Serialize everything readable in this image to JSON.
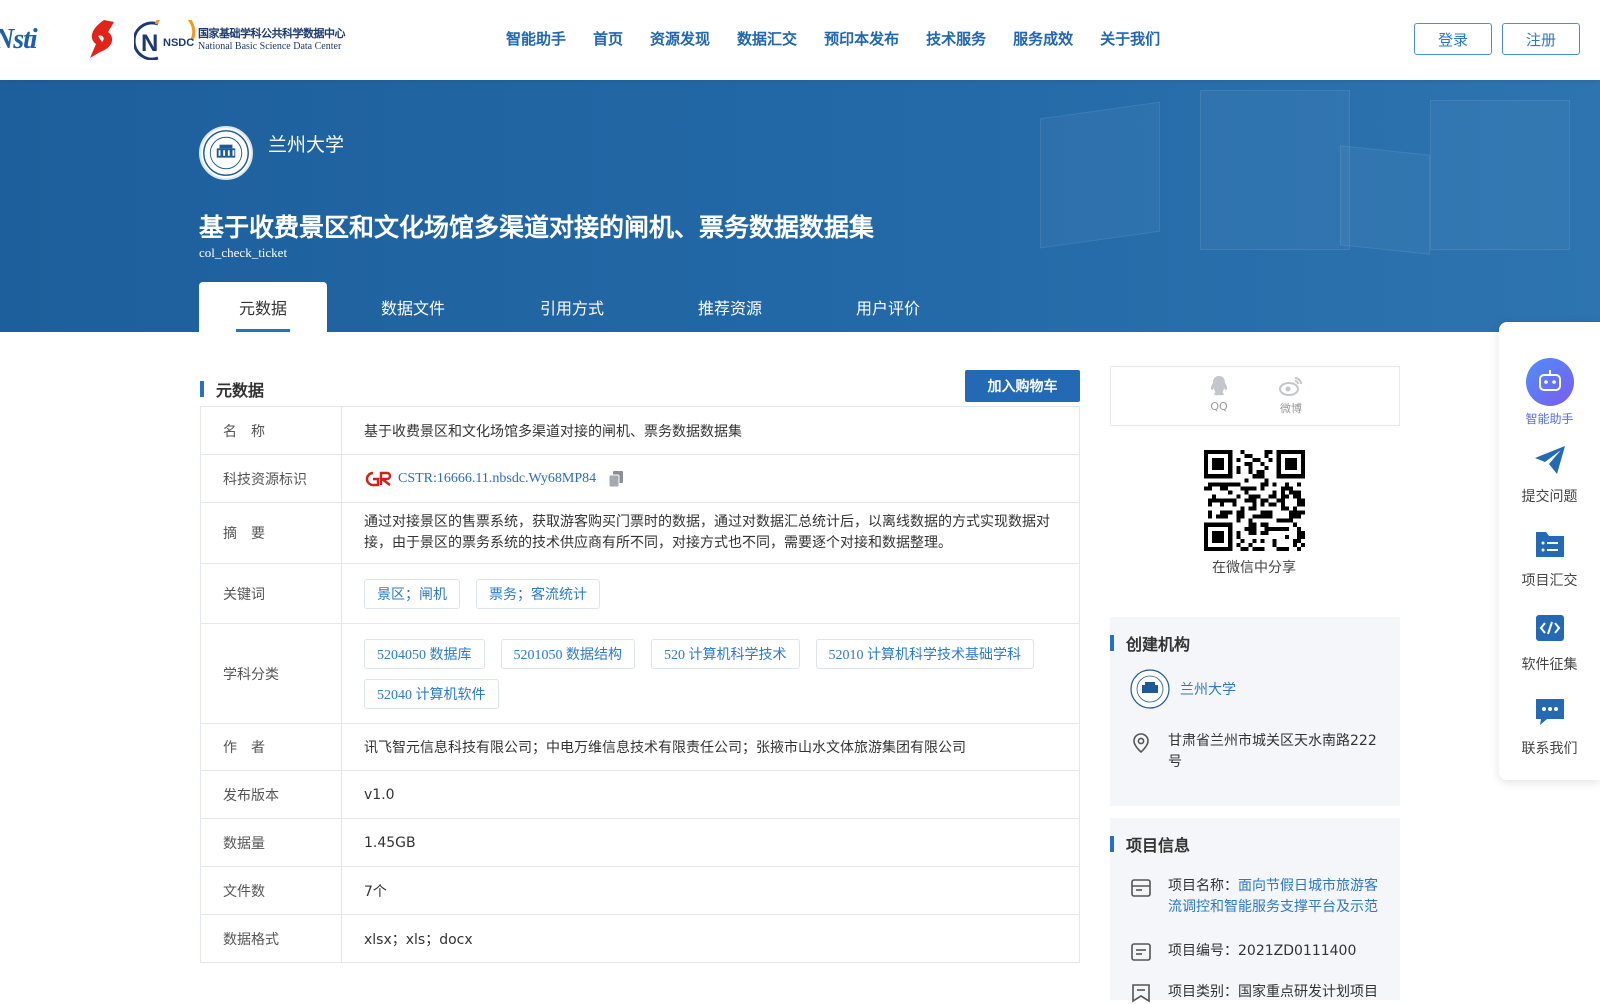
{
  "nav": {
    "items": [
      "智能助手",
      "首页",
      "资源发现",
      "数据汇交",
      "预印本发布",
      "技术服务",
      "服务成效",
      "关于我们"
    ],
    "login": "登录",
    "register": "注册"
  },
  "logos": {
    "nsti": "Nsti",
    "nsdc_badge": "NSDC",
    "nsdc_cn": "国家基础学科公共科学数据中心",
    "nsdc_en": "National Basic Science Data Center"
  },
  "header": {
    "institution": "兰州大学",
    "title": "基于收费景区和文化场馆多渠道对接的闸机、票务数据数据集",
    "code": "col_check_ticket",
    "tabs": [
      "元数据",
      "数据文件",
      "引用方式",
      "推荐资源",
      "用户评价"
    ]
  },
  "metadata": {
    "section_title": "元数据",
    "cart_button": "加入购物车",
    "rows": {
      "name": {
        "label": "名　称",
        "value": "基于收费景区和文化场馆多渠道对接的闸机、票务数据数据集"
      },
      "cstr": {
        "label": "科技资源标识",
        "value": "CSTR:16666.11.nbsdc.Wy68MP84"
      },
      "abstract": {
        "label": "摘　要",
        "value": "通过对接景区的售票系统，获取游客购买门票时的数据，通过对数据汇总统计后，以离线数据的方式实现数据对接，由于景区的票务系统的技术供应商有所不同，对接方式也不同，需要逐个对接和数据整理。"
      },
      "keywords": {
        "label": "关键词",
        "tags": [
          "景区；闸机",
          "票务；客流统计"
        ]
      },
      "subjects": {
        "label": "学科分类",
        "tags": [
          "5204050 数据库",
          "5201050 数据结构",
          "520 计算机科学技术",
          "52010 计算机科学技术基础学科",
          "52040 计算机软件"
        ]
      },
      "authors": {
        "label": "作　者",
        "value": "讯飞智元信息科技有限公司；中电万维信息技术有限责任公司；张掖市山水文体旅游集团有限公司"
      },
      "version": {
        "label": "发布版本",
        "value": "v1.0"
      },
      "size": {
        "label": "数据量",
        "value": "1.45GB"
      },
      "files": {
        "label": "文件数",
        "value": "7个"
      },
      "format": {
        "label": "数据格式",
        "value": "xlsx；xls；docx"
      }
    }
  },
  "share": {
    "qq": "QQ",
    "weibo": "微博",
    "wechat_caption": "在微信中分享"
  },
  "creator": {
    "title": "创建机构",
    "name": "兰州大学",
    "address": "甘肃省兰州市城关区天水南路222号"
  },
  "project": {
    "title": "项目信息",
    "name_label": "项目名称：",
    "name_value": "面向节假日城市旅游客流调控和智能服务支撑平台及示范",
    "number": "项目编号：2021ZD0111400",
    "category": "项目类别：国家重点研发计划项目"
  },
  "float_bar": {
    "items": [
      "智能助手",
      "提交问题",
      "项目汇交",
      "软件征集",
      "联系我们"
    ]
  },
  "colors": {
    "brand_blue": "#2469b3",
    "banner": "#1d5f9c",
    "link": "#2e78c7"
  }
}
